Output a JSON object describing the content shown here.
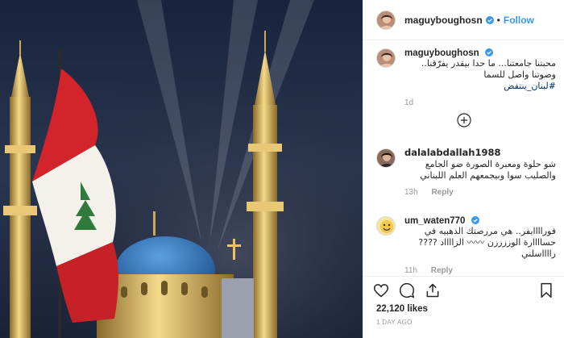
{
  "post": {
    "username": "maguyboughosn",
    "follow_label": "Follow",
    "separator": "•"
  },
  "caption": {
    "username": "maguyboughosn",
    "text": "محبتنا جامعتنا... ما حدا بيقدر يفرّقنا.. وصوتنا واصل للسما",
    "hashtag": "#لبنان_ينتفض",
    "time": "1d"
  },
  "comments": [
    {
      "username": "dalalabdallah1988",
      "text": "شو حلوة ومعبرة الصورة ضو الجامع والصليب سوا وبيجمعهم العلم اللبناني",
      "time": "13h",
      "reply_label": "Reply"
    },
    {
      "username": "um_waten770",
      "text": "فوراااايفر.. هي مررصتك الذهبيه في حساااارة الوززززن 〰〰 الزااااد ???? رااااسلني",
      "time": "11h",
      "reply_label": "Reply"
    }
  ],
  "actions": {
    "likes": "22,120 likes",
    "date": "1 DAY AGO"
  },
  "colors": {
    "link_blue": "#3897f0",
    "verified_blue": "#3897f0",
    "muted": "#999999",
    "text": "#262626",
    "border": "#efefef"
  },
  "icons": [
    "verified-badge-icon",
    "load-more-plus-icon",
    "heart-icon",
    "comment-icon",
    "share-icon",
    "bookmark-icon"
  ]
}
